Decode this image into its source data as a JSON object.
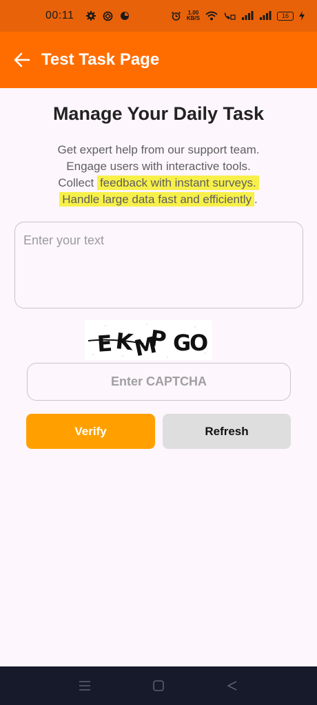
{
  "status": {
    "time": "00:11",
    "net_speed_value": "1.00",
    "net_speed_unit": "KB/S",
    "battery": "16"
  },
  "appbar": {
    "title": "Test Task Page",
    "back_icon": "arrow-left-icon"
  },
  "main": {
    "heading": "Manage Your Daily Task",
    "desc": {
      "line1": "Get expert help from our support team.",
      "line2": "Engage users with interactive tools.",
      "line3_plain": "Collect ",
      "line3_highlight": "feedback with instant surveys.",
      "line4_highlight": "Handle large data fast and efficiently",
      "line4_plain": "."
    },
    "text_input": {
      "placeholder": "Enter your text",
      "value": ""
    },
    "captcha": {
      "text": "EKMPGO"
    },
    "captcha_input": {
      "placeholder": "Enter CAPTCHA",
      "value": ""
    },
    "verify_label": "Verify",
    "refresh_label": "Refresh"
  },
  "colors": {
    "status_bar": "#e8620a",
    "app_bar": "#ff6d00",
    "verify": "#ffa000",
    "refresh": "#dedede",
    "highlight": "#f7f04a",
    "nav_bar": "#161a2b"
  }
}
